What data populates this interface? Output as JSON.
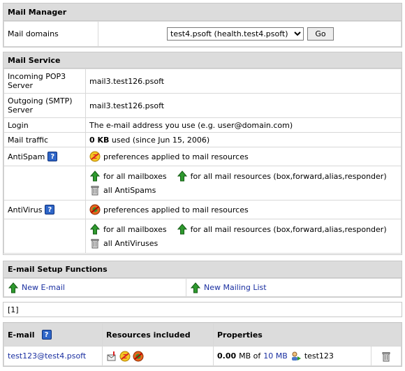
{
  "mail_manager": {
    "title": "Mail Manager",
    "domains_label": "Mail domains",
    "domain_selected": "test4.psoft (health.test4.psoft)",
    "go_label": "Go"
  },
  "mail_service": {
    "title": "Mail Service",
    "pop3_label": "Incoming POP3 Server",
    "pop3_value": "mail3.test126.psoft",
    "smtp_label": "Outgoing (SMTP) Server",
    "smtp_value": "mail3.test126.psoft",
    "login_label": "Login",
    "login_value": "The e-mail address you use (e.g. user@domain.com)",
    "traffic_label": "Mail traffic",
    "traffic_amount": "0 KB",
    "traffic_rest": "used (since Jun 15, 2006)",
    "antispam_label": "AntiSpam",
    "antispam_pref": "preferences applied to mail resources",
    "antispam_all_mailboxes": "for all mailboxes",
    "antispam_all_resources": "for all mail resources (box,forward,alias,responder)",
    "antispam_delete_all": "all AntiSpams",
    "antivirus_label": "AntiVirus",
    "antivirus_pref": "preferences applied to mail resources",
    "antivirus_all_mailboxes": "for all mailboxes",
    "antivirus_all_resources": "for all mail resources (box,forward,alias,responder)",
    "antivirus_delete_all": "all AntiViruses"
  },
  "setup": {
    "title": "E-mail Setup Functions",
    "new_email": "New E-mail",
    "new_mailing_list": "New Mailing List"
  },
  "pagination": {
    "current": "[1]"
  },
  "email_table": {
    "headers": {
      "email": "E-mail",
      "resources": "Resources included",
      "properties": "Properties"
    },
    "rows": [
      {
        "address": "test123@test4.psoft",
        "used": "0.00",
        "mb_of": "MB of",
        "quota": "10 MB",
        "owner": "test123"
      }
    ]
  },
  "colors": {
    "header_bg": "#dcdcdc",
    "link": "#1a2fa0",
    "help_blue": "#2f66c8",
    "add_green": "#2e9a2e"
  }
}
